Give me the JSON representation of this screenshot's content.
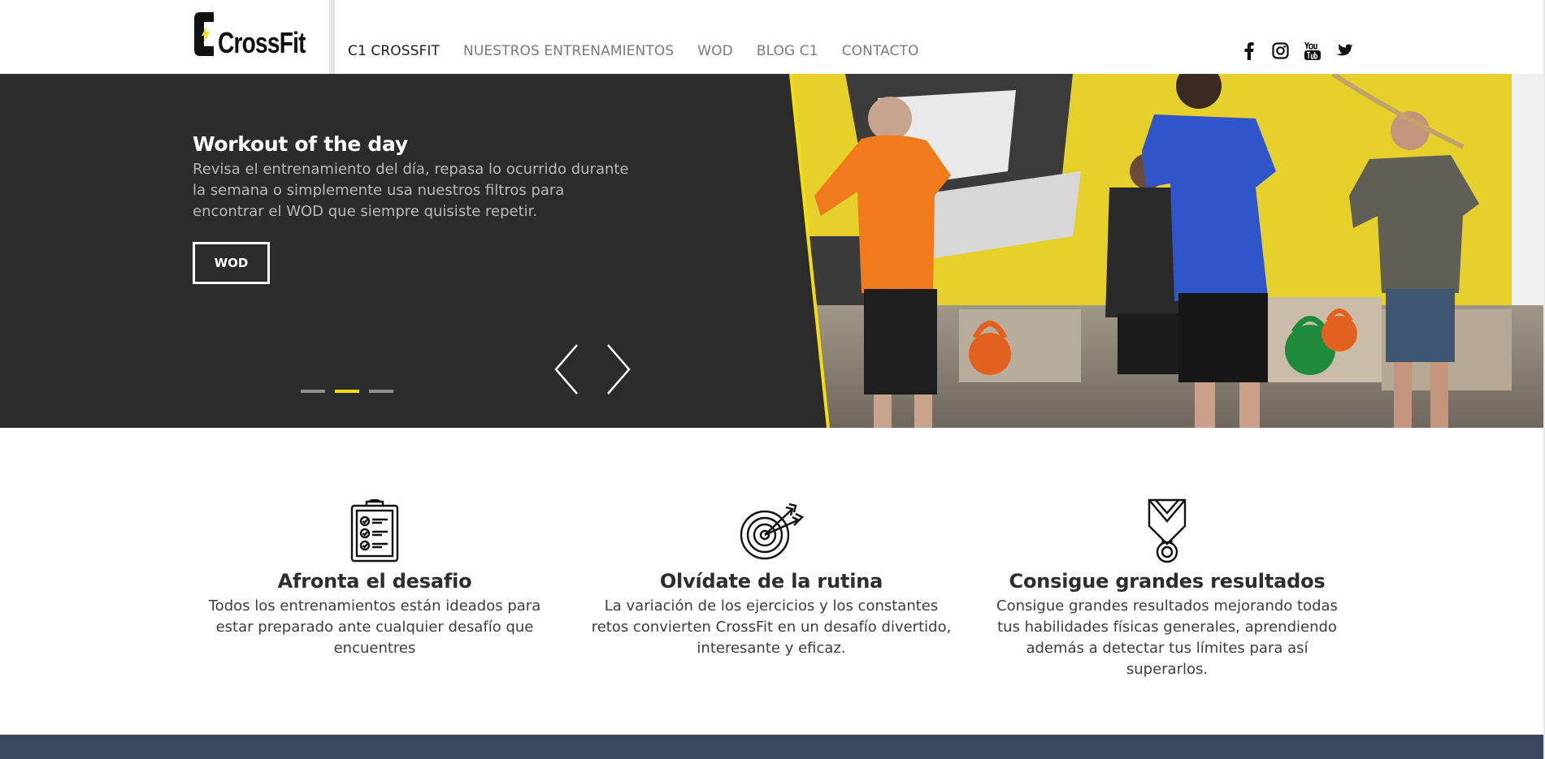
{
  "header": {
    "logo_text": "CrossFit",
    "nav": [
      {
        "label": "C1 CROSSFIT",
        "active": true
      },
      {
        "label": "NUESTROS ENTRENAMIENTOS",
        "active": false
      },
      {
        "label": "WOD",
        "active": false
      },
      {
        "label": "BLOG C1",
        "active": false
      },
      {
        "label": "CONTACTO",
        "active": false
      }
    ],
    "social": [
      "facebook-icon",
      "instagram-icon",
      "youtube-icon",
      "twitter-icon"
    ]
  },
  "hero": {
    "title": "Workout of the day",
    "description": "Revisa el entrenamiento del día, repasa lo ocurrido durante la semana o simplemente usa nuestros filtros para encontrar el WOD que siempre quisiste repetir.",
    "button_label": "WOD",
    "active_slide": 2,
    "slide_count": 3
  },
  "features": [
    {
      "icon": "clipboard-checklist-icon",
      "title": "Afronta el desafio",
      "text": "Todos los entrenamientos están ideados para estar preparado ante cualquier desafío que encuentres"
    },
    {
      "icon": "target-arrows-icon",
      "title": "Olvídate de la rutina",
      "text": "La variación de los ejercicios y los constantes retos convierten CrossFit en un desafío divertido, interesante y eficaz."
    },
    {
      "icon": "medal-icon",
      "title": "Consigue grandes resultados",
      "text": "Consigue grandes resultados mejorando todas tus habilidades físicas generales, aprendiendo además a detectar tus límites para así superarlos."
    }
  ],
  "colors": {
    "accent": "#f3dc0f",
    "hero_bg": "#2b2b2b",
    "footer_band": "#3a475e"
  }
}
